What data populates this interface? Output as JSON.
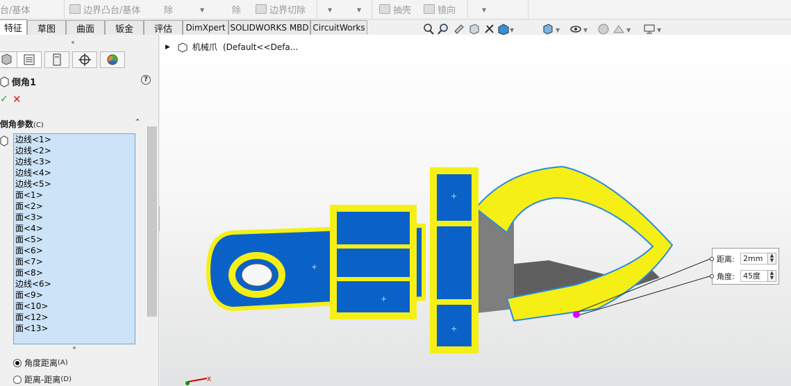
{
  "toolbar": {
    "items": [
      {
        "label": "台/基体",
        "icon": "boss-icon"
      },
      {
        "label": "边界凸台/基体",
        "icon": "boundary-boss-icon"
      },
      {
        "label": "除",
        "icon": "cut-icon"
      },
      {
        "label": "除",
        "icon": "cut-icon"
      },
      {
        "label": "边界切除",
        "icon": "boundary-cut-icon"
      },
      {
        "label": "抽壳",
        "icon": "shell-icon"
      },
      {
        "label": "镜向",
        "icon": "mirror-icon"
      }
    ]
  },
  "tabs": [
    {
      "label": "特征",
      "active": true
    },
    {
      "label": "草图"
    },
    {
      "label": "曲面"
    },
    {
      "label": "钣金"
    },
    {
      "label": "评估"
    },
    {
      "label": "DimXpert"
    },
    {
      "label": "SOLIDWORKS MBD"
    },
    {
      "label": "CircuitWorks"
    }
  ],
  "view_toolbar": [
    "zoom-to-fit-icon",
    "zoom-area-icon",
    "previous-view-icon",
    "section-view-icon",
    "dynamic-annotation-icon",
    "view-orientation-icon",
    "display-style-icon",
    "hide-show-icon",
    "edit-appearance-icon",
    "apply-scene-icon",
    "view-settings-icon"
  ],
  "panel": {
    "tab_icons": [
      "feature-manager-icon",
      "property-manager-icon",
      "configuration-manager-icon",
      "dimxpert-manager-icon",
      "display-manager-icon"
    ],
    "feature_title": "倒角1",
    "help_label": "?",
    "section_title": "倒角参数",
    "section_hotkey": "(C)",
    "items": [
      "边线<1>",
      "边线<2>",
      "边线<3>",
      "边线<4>",
      "边线<5>",
      "面<1>",
      "面<2>",
      "面<3>",
      "面<4>",
      "面<5>",
      "面<6>",
      "面<7>",
      "面<8>",
      "边线<6>",
      "面<9>",
      "面<10>",
      "面<12>",
      "面<13>"
    ],
    "options": [
      {
        "label": "角度距离",
        "hotkey": "(A)",
        "selected": true
      },
      {
        "label": "距离-距离",
        "hotkey": "(D)",
        "selected": false
      }
    ]
  },
  "tree": {
    "part_name": "机械爪",
    "config": "(Default<<Defa..."
  },
  "callout": {
    "distance_label": "距离:",
    "distance_value": "2mm",
    "angle_label": "角度:",
    "angle_value": "45度"
  },
  "colors": {
    "model_blue": "#0a62c8",
    "highlight_yellow": "#f5ef16",
    "background": "#f0f0f0",
    "list_bg": "#cde3f7"
  },
  "triad": {
    "x_label": "X"
  }
}
